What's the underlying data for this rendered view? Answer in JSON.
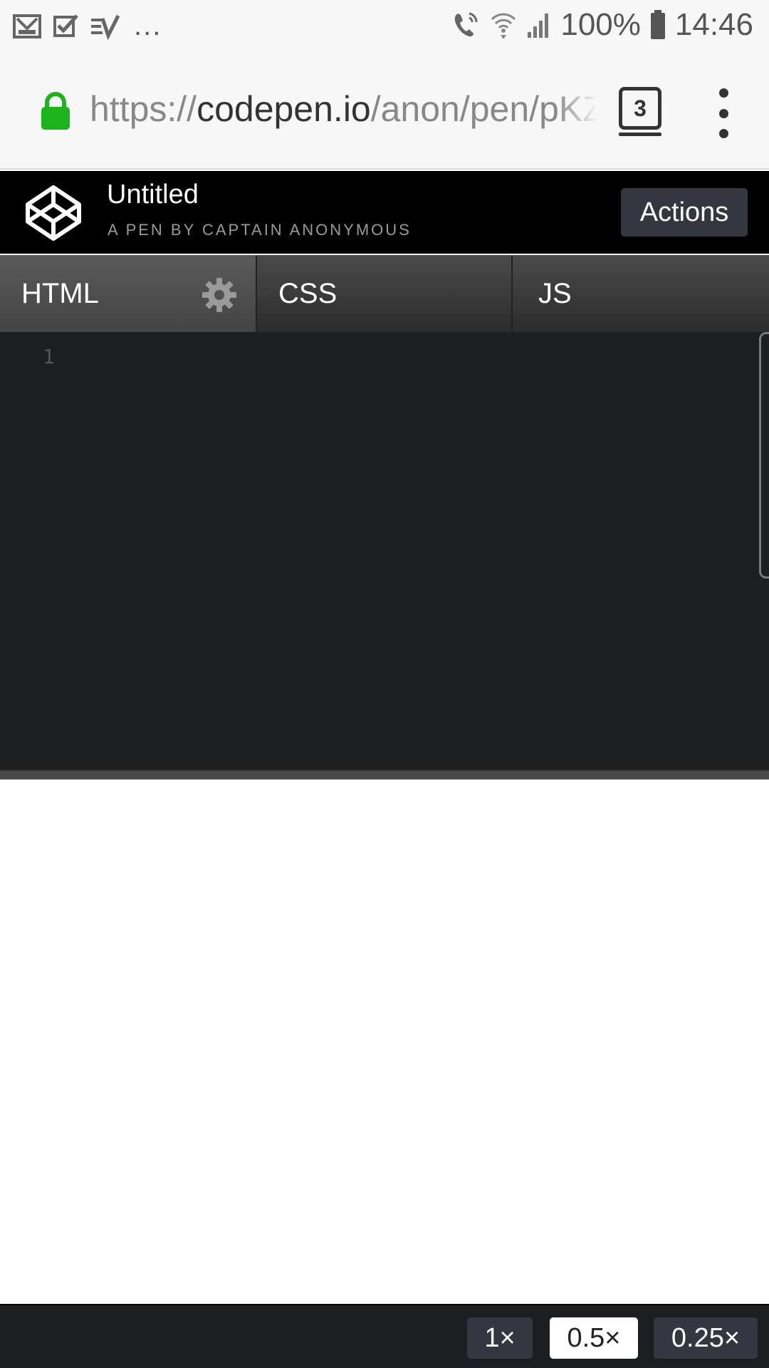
{
  "status_bar": {
    "battery": "100%",
    "time": "14:46",
    "overflow": "..."
  },
  "browser": {
    "url_scheme": "https://",
    "url_host": "codepen.io",
    "url_path": "/anon/pen/pKZ",
    "tab_count": "3",
    "lock_color": "#1db31d"
  },
  "header": {
    "title": "Untitled",
    "subtitle": "A PEN BY CAPTAIN ANONYMOUS",
    "actions_label": "Actions"
  },
  "editor": {
    "tabs": [
      {
        "label": "HTML",
        "active": true
      },
      {
        "label": "CSS",
        "active": false
      },
      {
        "label": "JS",
        "active": false
      }
    ],
    "line_number": "1"
  },
  "zoom": {
    "options": [
      {
        "label": "1×",
        "active": false
      },
      {
        "label": "0.5×",
        "active": true
      },
      {
        "label": "0.25×",
        "active": false
      }
    ]
  }
}
